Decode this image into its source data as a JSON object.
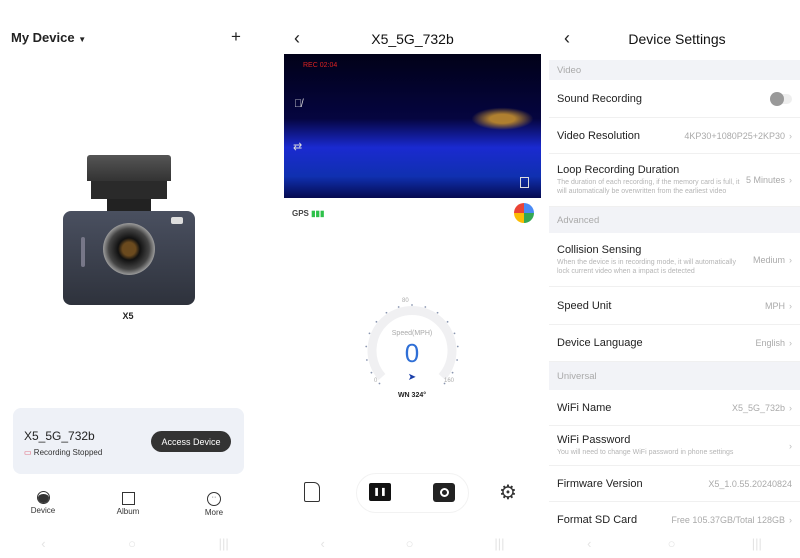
{
  "home": {
    "title": "My Device",
    "device_model": "X5",
    "card": {
      "name": "X5_5G_732b",
      "status": "Recording Stopped",
      "button": "Access Device"
    },
    "tabs": [
      {
        "label": "Device",
        "icon": "dashcam-icon"
      },
      {
        "label": "Album",
        "icon": "album-icon"
      },
      {
        "label": "More",
        "icon": "more-icon"
      }
    ]
  },
  "live": {
    "title": "X5_5G_732b",
    "rec_overlay": "REC 02:04",
    "gps_label": "GPS",
    "speed": {
      "label": "Speed(MPH)",
      "value": "0",
      "min": "0",
      "mid": "80",
      "max": "160",
      "heading": "WN 324°"
    }
  },
  "settings": {
    "title": "Device Settings",
    "sections": {
      "video": "Video",
      "advanced": "Advanced",
      "universal": "Universal"
    },
    "rows": {
      "sound": {
        "label": "Sound Recording",
        "enabled": false
      },
      "resolution": {
        "label": "Video Resolution",
        "value": "4KP30+1080P25+2KP30"
      },
      "loop": {
        "label": "Loop Recording Duration",
        "desc": "The duration of each recording, if the memory card is full, it will automatically be overwritten from the earliest video",
        "value": "5 Minutes"
      },
      "collision": {
        "label": "Collision Sensing",
        "desc": "When the device is in recording mode, it will automatically lock current video when a impact is detected",
        "value": "Medium"
      },
      "speed_unit": {
        "label": "Speed Unit",
        "value": "MPH"
      },
      "language": {
        "label": "Device Language",
        "value": "English"
      },
      "wifi_name": {
        "label": "WiFi Name",
        "value": "X5_5G_732b"
      },
      "wifi_pass": {
        "label": "WiFi Password",
        "desc": "You will need to change WiFi password in phone settings"
      },
      "firmware": {
        "label": "Firmware Version",
        "value": "X5_1.0.55.20240824"
      },
      "sd": {
        "label": "Format SD Card",
        "value": "Free 105.37GB/Total 128GB"
      }
    }
  },
  "colors": {
    "accent": "#2f6fd6",
    "record_red": "#e0556a",
    "gps_green": "#2ec14a",
    "card_bg": "#eef1f7"
  }
}
